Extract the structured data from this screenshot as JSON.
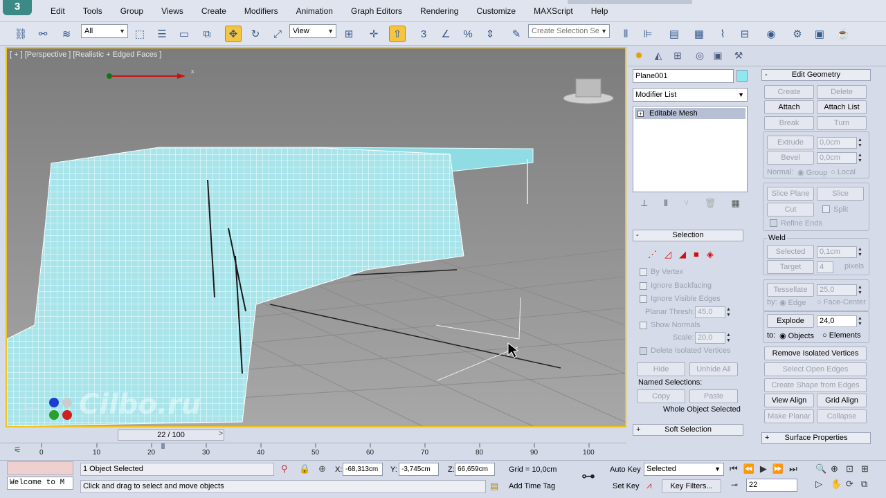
{
  "menu": [
    "Edit",
    "Tools",
    "Group",
    "Views",
    "Create",
    "Modifiers",
    "Animation",
    "Graph Editors",
    "Rendering",
    "Customize",
    "MAXScript",
    "Help"
  ],
  "toolbar": {
    "filter_value": "All",
    "coord_value": "View",
    "named_selection_placeholder": "Create Selection Se"
  },
  "viewport": {
    "label": "[ + ] [Perspective ] [Realistic + Edged Faces ]",
    "axis_x": "x",
    "watermark": "Cilbo.ru"
  },
  "command_panel": {
    "object_name": "Plane001",
    "object_color": "#8fe8ef",
    "modifier_list_label": "Modifier List",
    "stack_item": "Editable Mesh",
    "selection": {
      "title": "Selection",
      "by_vertex": "By Vertex",
      "ignore_backfacing": "Ignore Backfacing",
      "ignore_visible_edges": "Ignore Visible Edges",
      "planar_thresh_label": "Planar Thresh:",
      "planar_thresh_value": "45,0",
      "show_normals": "Show Normals",
      "scale_label": "Scale:",
      "scale_value": "20,0",
      "delete_isolated": "Delete Isolated Vertices",
      "hide": "Hide",
      "unhide_all": "Unhide All",
      "named_selections": "Named Selections:",
      "copy": "Copy",
      "paste": "Paste",
      "status": "Whole Object Selected"
    },
    "soft_selection": "Soft Selection",
    "edit_geometry": {
      "title": "Edit Geometry",
      "create": "Create",
      "delete": "Delete",
      "attach": "Attach",
      "attach_list": "Attach List",
      "break": "Break",
      "turn": "Turn",
      "extrude": "Extrude",
      "extrude_value": "0,0cm",
      "bevel": "Bevel",
      "bevel_value": "0,0cm",
      "normal_label": "Normal:",
      "group": "Group",
      "local": "Local",
      "slice_plane": "Slice Plane",
      "slice": "Slice",
      "cut": "Cut",
      "split": "Split",
      "refine_ends": "Refine Ends",
      "weld": "Weld",
      "selected": "Selected",
      "selected_value": "0,1cm",
      "target": "Target",
      "target_value": "4",
      "pixels": "pixels",
      "tessellate": "Tessellate",
      "tessellate_value": "25,0",
      "by_label": "by:",
      "edge": "Edge",
      "face_center": "Face-Center",
      "explode": "Explode",
      "explode_value": "24,0",
      "to_label": "to:",
      "objects": "Objects",
      "elements": "Elements",
      "remove_isolated": "Remove Isolated Vertices",
      "select_open_edges": "Select Open Edges",
      "create_shape": "Create Shape from Edges",
      "view_align": "View Align",
      "grid_align": "Grid Align",
      "make_planar": "Make Planar",
      "collapse": "Collapse"
    },
    "surface_properties": "Surface Properties"
  },
  "timeline": {
    "frame": "22 / 100",
    "ticks": [
      "0",
      "10",
      "20",
      "30",
      "40",
      "50",
      "60",
      "70",
      "80",
      "90",
      "100"
    ]
  },
  "status": {
    "objects_selected": "1 Object Selected",
    "prompt": "Click and drag to select and move objects",
    "maxscript": "Welcome to M",
    "x_label": "X:",
    "x_value": "-68,313cm",
    "y_label": "Y:",
    "y_value": "-3,745cm",
    "z_label": "Z:",
    "z_value": "66,659cm",
    "grid": "Grid = 10,0cm",
    "add_time_tag": "Add Time Tag",
    "auto_key": "Auto Key",
    "set_key": "Set Key",
    "selected_dropdown": "Selected",
    "key_filters": "Key Filters...",
    "current_frame": "22"
  }
}
